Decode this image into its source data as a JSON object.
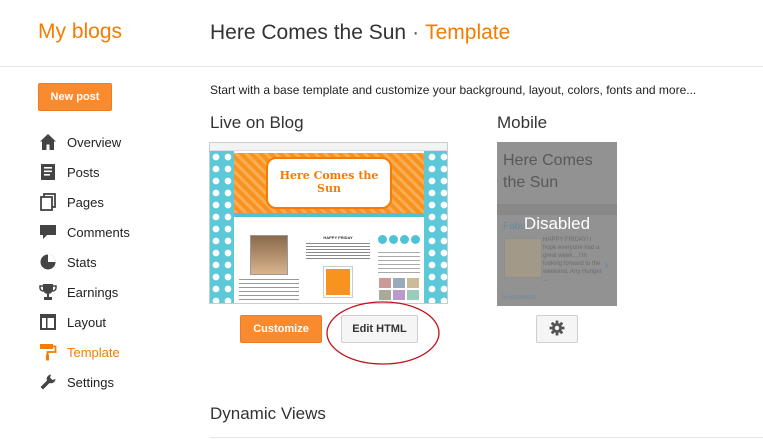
{
  "header": {
    "brand": "My blogs",
    "blog_title": "Here Comes the Sun",
    "separator": "·",
    "page": "Template"
  },
  "sidebar": {
    "new_post_label": "New post",
    "items": [
      {
        "label": "Overview",
        "icon": "home-icon"
      },
      {
        "label": "Posts",
        "icon": "posts-icon"
      },
      {
        "label": "Pages",
        "icon": "pages-icon"
      },
      {
        "label": "Comments",
        "icon": "comments-icon"
      },
      {
        "label": "Stats",
        "icon": "stats-icon"
      },
      {
        "label": "Earnings",
        "icon": "trophy-icon"
      },
      {
        "label": "Layout",
        "icon": "layout-icon"
      },
      {
        "label": "Template",
        "icon": "paint-roller-icon",
        "active": true
      },
      {
        "label": "Settings",
        "icon": "wrench-icon"
      }
    ]
  },
  "main": {
    "intro": "Start with a base template and customize your background, layout, colors, fonts and more...",
    "live_label": "Live on Blog",
    "mobile_label": "Mobile",
    "customize_label": "Customize",
    "edit_html_label": "Edit HTML",
    "mobile_title": "Here Comes the Sun",
    "mobile_status": "Disabled",
    "mobile_snippet": "HAPPY FRIDAY! I hope everyone had a great week... I'm looking forward to the weekend. Any Hunger ...",
    "mobile_link": "Fabul",
    "mobile_comments": "5 comments",
    "preview_banner": "Here Comes the Sun",
    "preview_post_title": "HAPPY FRIDAY",
    "dynamic_views_label": "Dynamic Views"
  },
  "colors": {
    "accent": "#f57c00",
    "button_orange": "#f98b2e",
    "annotation_circle": "#c0121c",
    "teal": "#4fc3d6"
  }
}
